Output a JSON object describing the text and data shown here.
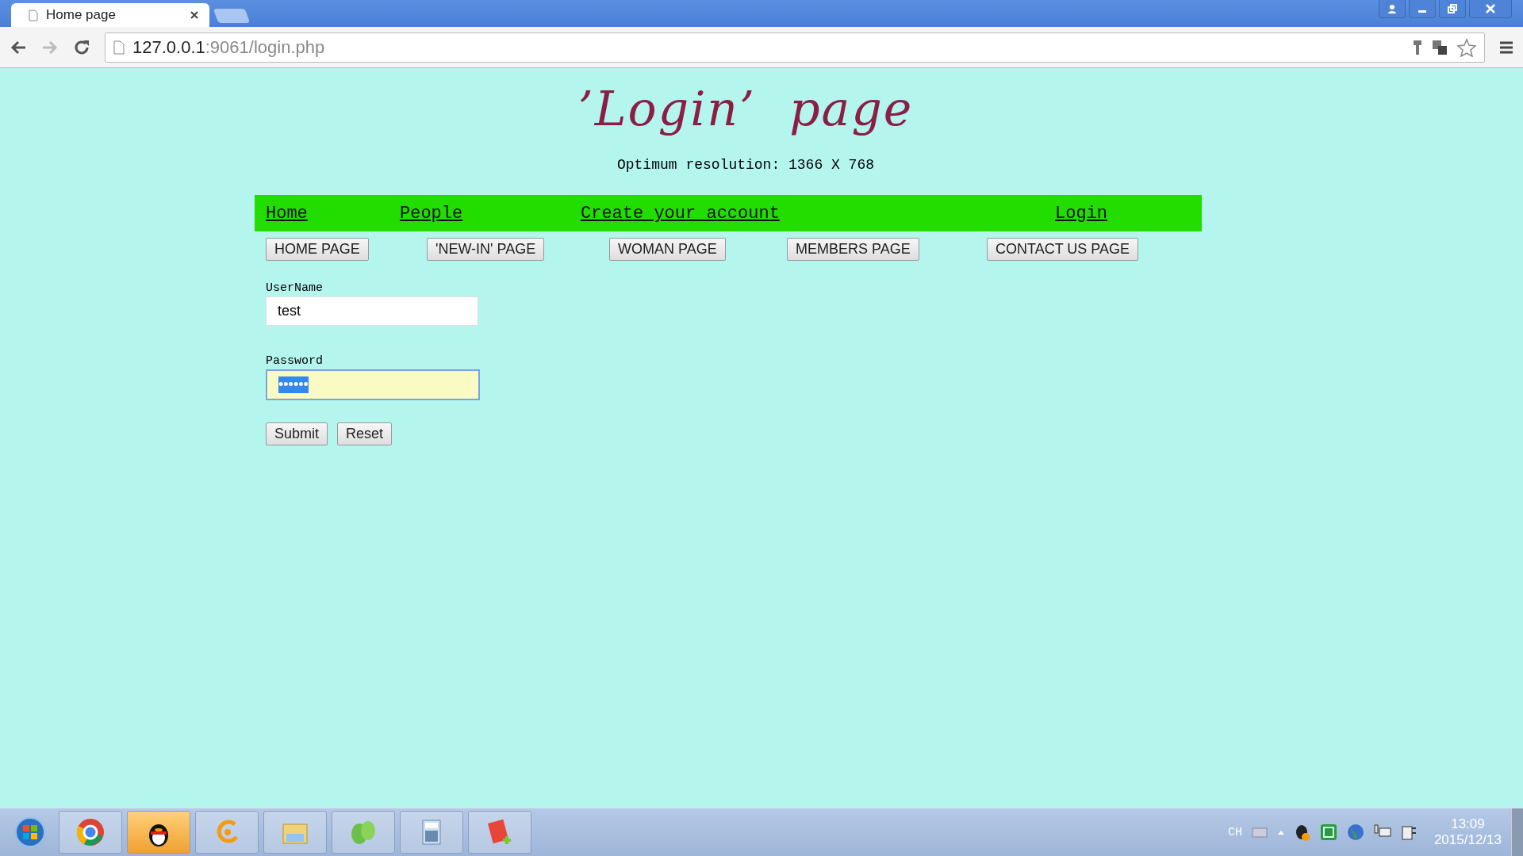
{
  "browser": {
    "tab": {
      "title": "Home page"
    },
    "address": {
      "host": "127.0.0.1",
      "rest": ":9061/login.php"
    }
  },
  "page": {
    "title": "’Login’  page",
    "resolution_note": "Optimum resolution: 1366 X 768",
    "nav_links": [
      "Home",
      "People",
      "Create your account",
      "Login"
    ],
    "section_buttons": [
      "HOME PAGE",
      "'NEW-IN' PAGE",
      "WOMAN PAGE",
      "MEMBERS PAGE",
      "CONTACT US PAGE"
    ],
    "form": {
      "username": {
        "label": "UserName",
        "value": "test",
        "focused": false
      },
      "password": {
        "label": "Password",
        "value": "••••••",
        "focused": true,
        "text_selected": true
      },
      "buttons": [
        "Submit",
        "Reset"
      ]
    }
  },
  "taskbar": {
    "buttons": [
      {
        "highlighted": false
      },
      {
        "highlighted": true
      },
      {
        "highlighted": false
      },
      {
        "highlighted": false
      },
      {
        "highlighted": false
      },
      {
        "highlighted": false
      },
      {
        "highlighted": false
      }
    ],
    "language": "CH",
    "time": "13:09",
    "date": "2015/12/13"
  }
}
